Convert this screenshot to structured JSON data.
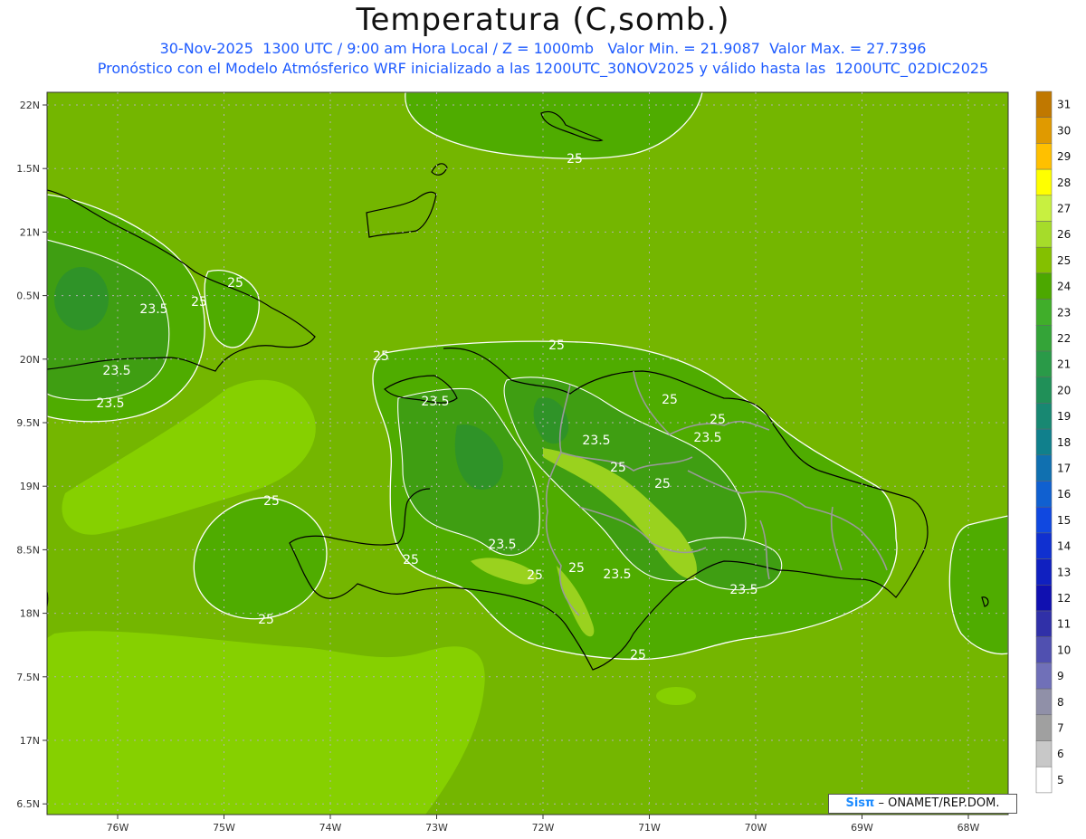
{
  "header": {
    "title": "Temperatura (C,somb.)",
    "subtitle1": "30-Nov-2025  1300 UTC / 9:00 am Hora Local / Z = 1000mb   Valor Min. = 21.9087  Valor Max. = 27.7396",
    "subtitle2": "Pronóstico con el Modelo Atmósferico WRF inicializado a las 1200UTC_30NOV2025 y válido hasta las  1200UTC_02DIC2025"
  },
  "axes": {
    "lat_labels": [
      "22N",
      "1.5N",
      "21N",
      "0.5N",
      "20N",
      "9.5N",
      "19N",
      "8.5N",
      "18N",
      "7.5N",
      "17N",
      "6.5N"
    ],
    "lon_labels": [
      "76W",
      "75W",
      "74W",
      "73W",
      "72W",
      "71W",
      "70W",
      "69W",
      "68W"
    ]
  },
  "colorbar": {
    "labels": [
      "31",
      "30",
      "29",
      "28",
      "27",
      "26",
      "25",
      "24",
      "23",
      "22",
      "21",
      "20",
      "19",
      "18",
      "17",
      "16",
      "15",
      "14",
      "13",
      "12",
      "11",
      "10",
      "9",
      "8",
      "7",
      "6",
      "5"
    ],
    "colors": [
      "#c07800",
      "#e09a00",
      "#ffc000",
      "#ffff00",
      "#c8f040",
      "#a6dc2a",
      "#84c000",
      "#4ca800",
      "#40ae2a",
      "#34a438",
      "#2a9a48",
      "#209058",
      "#188872",
      "#10808c",
      "#1070b0",
      "#1060d0",
      "#1048e0",
      "#1030d0",
      "#1020c0",
      "#1010b0",
      "#3030a8",
      "#5050b0",
      "#7070b8",
      "#9090a8",
      "#a0a0a0",
      "#c8c8c8",
      "#ffffff"
    ]
  },
  "contour_labels": {
    "c25": "25",
    "c235": "23.5"
  },
  "credit": {
    "logo": "Sisπ",
    "text": "ONAMET/REP.DOM."
  }
}
